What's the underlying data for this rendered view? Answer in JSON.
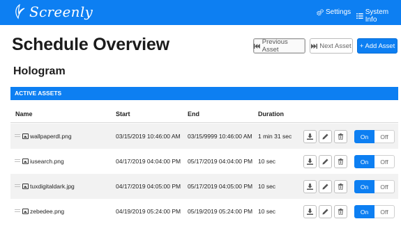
{
  "navbar": {
    "brand": "Screenly",
    "settings": "Settings",
    "system_info": "System Info"
  },
  "header": {
    "title": "Schedule Overview",
    "prev_label": "Previous Asset",
    "next_label": "Next Asset",
    "add_label": "+ Add Asset"
  },
  "section": {
    "title": "Hologram"
  },
  "assets": {
    "bar_title": "ACTIVE ASSETS",
    "columns": [
      "Name",
      "Start",
      "End",
      "Duration"
    ],
    "rows": [
      {
        "name": "wallpaperdl.png",
        "start": "03/15/2019 10:46:00 AM",
        "end": "03/15/9999 10:46:00 AM",
        "duration": "1 min 31 sec",
        "on": "On",
        "off": "Off"
      },
      {
        "name": "iusearch.png",
        "start": "04/17/2019 04:04:00 PM",
        "end": "05/17/2019 04:04:00 PM",
        "duration": "10 sec",
        "on": "On",
        "off": "Off"
      },
      {
        "name": "tuxdigitaldark.jpg",
        "start": "04/17/2019 04:05:00 PM",
        "end": "05/17/2019 04:05:00 PM",
        "duration": "10 sec",
        "on": "On",
        "off": "Off"
      },
      {
        "name": "zebedee.png",
        "start": "04/19/2019 05:24:00 PM",
        "end": "05/19/2019 05:24:00 PM",
        "duration": "10 sec",
        "on": "On",
        "off": "Off"
      }
    ]
  },
  "colors": {
    "primary": "#0d7ff2",
    "row_alt": "#f2f2f2"
  },
  "icons": {
    "brand": "screenly-logo-icon",
    "settings": "cogs-icon",
    "system_info": "list-icon",
    "prev": "fast-backward-icon",
    "next": "fast-forward-icon",
    "drag": "drag-handle-icon",
    "file": "image-file-icon",
    "download": "download-icon",
    "edit": "pencil-icon",
    "delete": "trash-icon"
  }
}
